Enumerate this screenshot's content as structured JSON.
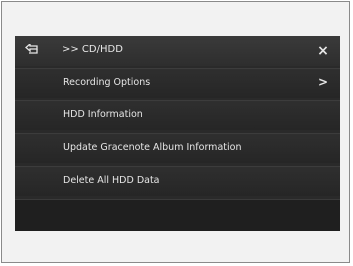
{
  "header": {
    "back_icon": "back-arrow-icon",
    "breadcrumb": ">> CD/HDD",
    "close_label": "×"
  },
  "menu": {
    "items": [
      {
        "label": "Recording Options",
        "chevron": ">"
      },
      {
        "label": "HDD Information"
      },
      {
        "label": "Update Gracenote Album Information"
      },
      {
        "label": "Delete All HDD Data"
      }
    ]
  },
  "colors": {
    "screen_bg": "#2a2a2a",
    "text": "#e6e6e6",
    "frame_bg": "#f2f2f2"
  }
}
